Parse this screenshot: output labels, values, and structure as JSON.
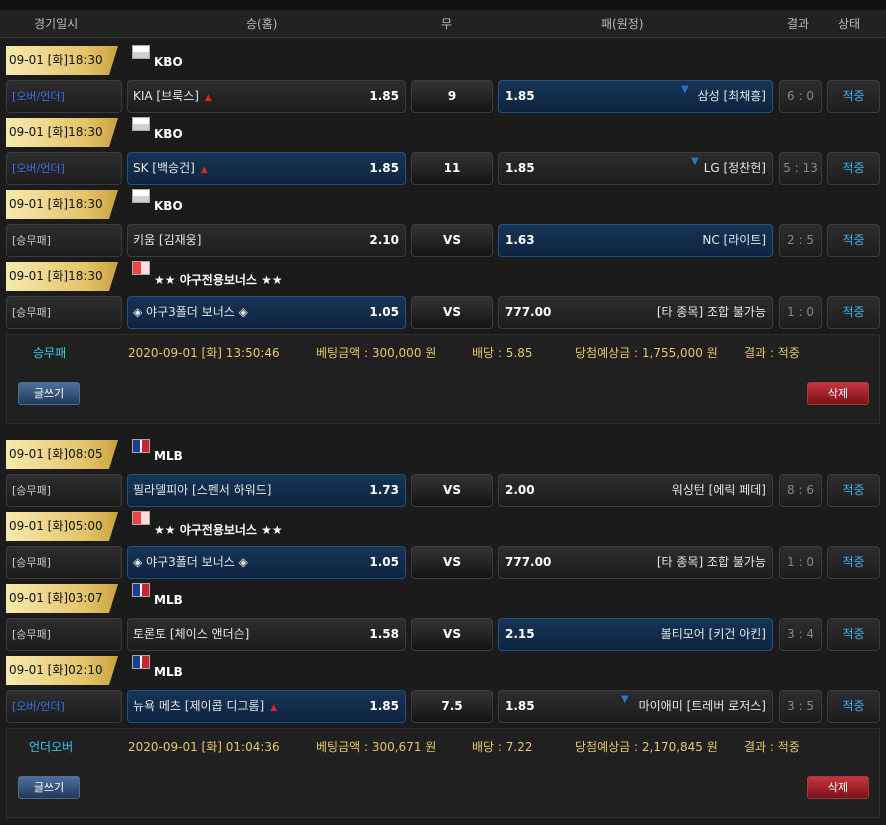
{
  "header": {
    "date_col": "경기일시",
    "home_col": "승(홈)",
    "draw_col": "무",
    "away_col": "패(원정)",
    "result_col": "결과",
    "status_col": "상태"
  },
  "groups": [
    {
      "games": [
        {
          "date": "09-01 [화]18:30",
          "league": "KBO",
          "league_icon": "kbo-flag-icon",
          "type": "[오버/언더]",
          "home_team": "KIA [브룩스]",
          "home_odd": "1.85",
          "home_arrow": "▲",
          "draw": "9",
          "away_odd": "1.85",
          "away_team": "삼성 [최채흥]",
          "away_arrow": "▼",
          "result": "6 : 0",
          "status": "적중"
        },
        {
          "date": "09-01 [화]18:30",
          "league": "KBO",
          "league_icon": "kbo-flag-icon",
          "type": "[오버/언더]",
          "home_team": "SK [백승건]",
          "home_odd": "1.85",
          "home_arrow": "▲",
          "draw": "11",
          "away_odd": "1.85",
          "away_team": "LG [정찬헌]",
          "away_arrow": "▼",
          "result": "5 : 13",
          "status": "적중"
        },
        {
          "date": "09-01 [화]18:30",
          "league": "KBO",
          "league_icon": "kbo-flag-icon",
          "type": "[승무패]",
          "home_team": "키움 [김재웅]",
          "home_odd": "2.10",
          "home_arrow": "",
          "draw": "VS",
          "away_odd": "1.63",
          "away_team": "NC [라이트]",
          "away_arrow": "",
          "result": "2 : 5",
          "status": "적중"
        },
        {
          "date": "09-01 [화]18:30",
          "league": "★★ 야구전용보너스 ★★",
          "league_icon": "bonus-icon",
          "type": "[승무패]",
          "home_team": "◈ 야구3폴더 보너스 ◈",
          "home_odd": "1.05",
          "home_arrow": "",
          "draw": "VS",
          "away_odd": "777.00",
          "away_team": "[타 종목] 조합 불가능",
          "away_arrow": "",
          "result": "1 : 0",
          "status": "적중"
        }
      ],
      "summary": {
        "kind": "승무패",
        "datetime": "2020-09-01 [화] 13:50:46",
        "bet": "베팅금액 : 300,000 원",
        "odds": "배당 : 5.85",
        "expected": "당첨예상금 : 1,755,000 원",
        "result": "결과 : 적중",
        "write_label": "글쓰기",
        "delete_label": "삭제"
      }
    },
    {
      "games": [
        {
          "date": "09-01 [화]08:05",
          "league": "MLB",
          "league_icon": "mlb-logo-icon",
          "type": "[승무패]",
          "home_team": "필라델피아 [스펜서 하워드]",
          "home_odd": "1.73",
          "home_arrow": "",
          "draw": "VS",
          "away_odd": "2.00",
          "away_team": "워싱턴 [에릭 페데]",
          "away_arrow": "",
          "result": "8 : 6",
          "status": "적중"
        },
        {
          "date": "09-01 [화]05:00",
          "league": "★★ 야구전용보너스 ★★",
          "league_icon": "bonus-icon",
          "type": "[승무패]",
          "home_team": "◈ 야구3폴더 보너스 ◈",
          "home_odd": "1.05",
          "home_arrow": "",
          "draw": "VS",
          "away_odd": "777.00",
          "away_team": "[타 종목] 조합 불가능",
          "away_arrow": "",
          "result": "1 : 0",
          "status": "적중"
        },
        {
          "date": "09-01 [화]03:07",
          "league": "MLB",
          "league_icon": "mlb-logo-icon",
          "type": "[승무패]",
          "home_team": "토론토 [체이스 앤더슨]",
          "home_odd": "1.58",
          "home_arrow": "",
          "draw": "VS",
          "away_odd": "2.15",
          "away_team": "볼티모어 [키건 아킨]",
          "away_arrow": "",
          "result": "3 : 4",
          "status": "적중"
        },
        {
          "date": "09-01 [화]02:10",
          "league": "MLB",
          "league_icon": "mlb-logo-icon",
          "type": "[오버/언더]",
          "home_team": "뉴욕 메츠 [제이콥 디그롬]",
          "home_odd": "1.85",
          "home_arrow": "▲",
          "draw": "7.5",
          "away_odd": "1.85",
          "away_team": "마이애미 [트레버 로저스]",
          "away_arrow": "▼",
          "result": "3 : 5",
          "status": "적중"
        }
      ],
      "summary": {
        "kind": "언더오버",
        "datetime": "2020-09-01 [화] 01:04:36",
        "bet": "베팅금액 : 300,671 원",
        "odds": "배당 : 7.22",
        "expected": "당첨예상금 : 2,170,845 원",
        "result": "결과 : 적중",
        "write_label": "글쓰기",
        "delete_label": "삭제"
      }
    }
  ],
  "colors": {
    "accent_blue": "#3fb0ee",
    "gold": "#e3c46a",
    "delete_red": "#c5343f",
    "selected_bg": "#173455"
  }
}
